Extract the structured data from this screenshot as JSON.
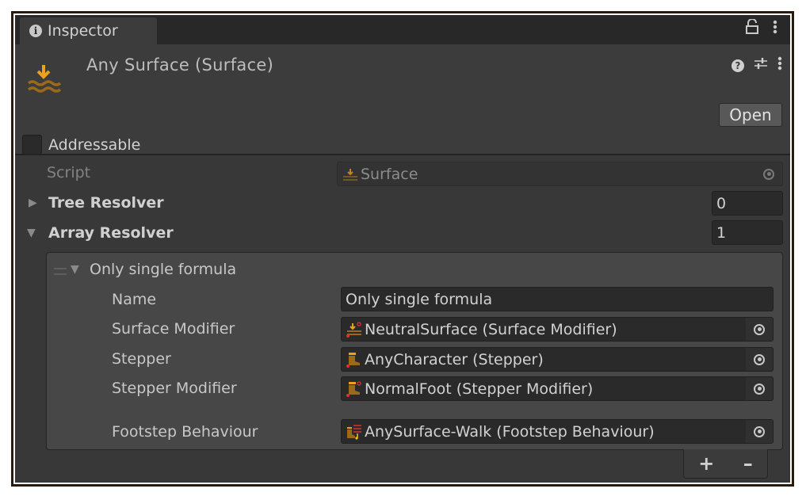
{
  "window": {
    "tab_label": "Inspector",
    "tab_icon": "info-icon",
    "actions": [
      "lock-icon",
      "more-vert-icon"
    ]
  },
  "header": {
    "title": "Any Surface (Surface)",
    "icons": [
      "help-icon",
      "preset-sliders-icon",
      "more-vert-icon"
    ],
    "open_button": "Open",
    "addressable_label": "Addressable",
    "addressable_checked": false
  },
  "properties": {
    "script": {
      "label": "Script",
      "value": "Surface"
    },
    "tree_resolver": {
      "label": "Tree Resolver",
      "count": "0",
      "expanded": false
    },
    "array_resolver": {
      "label": "Array Resolver",
      "count": "1",
      "expanded": true
    }
  },
  "array_element": {
    "title": "Only single formula",
    "fields": [
      {
        "label": "Name",
        "value": "Only single formula"
      },
      {
        "label": "Surface Modifier",
        "value": "NeutralSurface (Surface Modifier)",
        "icon": "surface-modifier-icon"
      },
      {
        "label": "Stepper",
        "value": "AnyCharacter (Stepper)",
        "icon": "stepper-icon"
      },
      {
        "label": "Stepper Modifier",
        "value": "NormalFoot (Stepper Modifier)",
        "icon": "stepper-modifier-icon"
      },
      {
        "label": "Footstep Behaviour",
        "value": "AnySurface-Walk (Footstep Behaviour)",
        "icon": "footstep-behaviour-icon"
      }
    ]
  },
  "list_footer": {
    "add": "+",
    "remove": "–"
  },
  "colors": {
    "accent": "#f0a020",
    "icon_brown": "#9a6a1a",
    "badge_red": "#e03030"
  }
}
